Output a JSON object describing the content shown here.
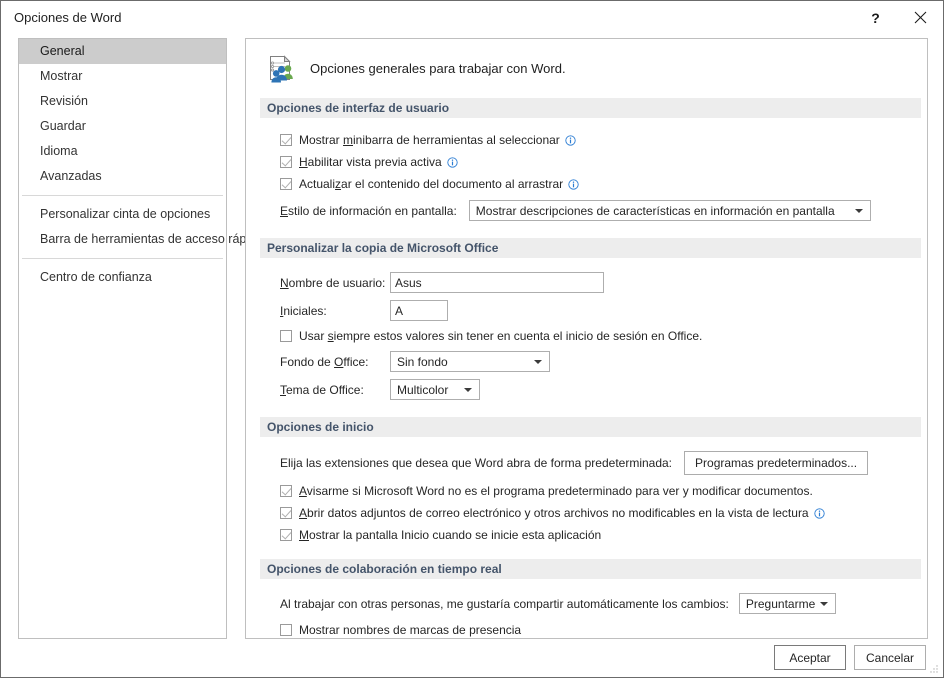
{
  "window": {
    "title": "Opciones de Word",
    "help_button": "?",
    "close_button": "✕"
  },
  "sidebar": {
    "items": [
      {
        "label": "General",
        "selected": true
      },
      {
        "label": "Mostrar",
        "selected": false
      },
      {
        "label": "Revisión",
        "selected": false
      },
      {
        "label": "Guardar",
        "selected": false
      },
      {
        "label": "Idioma",
        "selected": false
      },
      {
        "label": "Avanzadas",
        "selected": false
      },
      {
        "label": "Personalizar cinta de opciones",
        "selected": false
      },
      {
        "label": "Barra de herramientas de acceso rápido",
        "selected": false
      },
      {
        "label": "Centro de confianza",
        "selected": false
      }
    ]
  },
  "pane": {
    "header_text": "Opciones generales para trabajar con Word.",
    "header_icon": "general-options-icon"
  },
  "ui_section": {
    "title": "Opciones de interfaz de usuario",
    "cb_minibar": {
      "pre": "Mostrar ",
      "key": "m",
      "post": "inibarra de herramientas al seleccionar",
      "checked": true,
      "info": true
    },
    "cb_livepreview": {
      "pre": "",
      "key": "H",
      "post": "abilitar vista previa activa",
      "checked": true,
      "info": true
    },
    "cb_update_drag": {
      "pre": "Actuali",
      "key": "z",
      "post": "ar el contenido del documento al arrastrar",
      "checked": true,
      "info": true
    },
    "screentip_label": {
      "pre": "",
      "key": "E",
      "post": "stilo de información en pantalla:"
    },
    "screentip_value": "Mostrar descripciones de características en información en pantalla"
  },
  "personalize_section": {
    "title": "Personalizar la copia de Microsoft Office",
    "username_label": {
      "pre": "",
      "key": "N",
      "post": "ombre de usuario:"
    },
    "username_value": "Asus",
    "initials_label": {
      "pre": "",
      "key": "I",
      "post": "niciales:"
    },
    "initials_value": "A",
    "cb_always_use": {
      "pre": "Usar ",
      "key": "s",
      "post": "iempre estos valores sin tener en cuenta el inicio de sesión en Office.",
      "checked": false,
      "info": false
    },
    "background_label": {
      "pre": "Fondo de ",
      "key": "O",
      "post": "ffice:"
    },
    "background_value": "Sin fondo",
    "theme_label": {
      "pre": "",
      "key": "T",
      "post": "ema de Office:"
    },
    "theme_value": "Multicolor"
  },
  "startup_section": {
    "title": "Opciones de inicio",
    "extensions_label": "Elija las extensiones que desea que Word abra de forma predeterminada:",
    "default_programs_button": "Programas predeterminados...",
    "cb_warn_default": {
      "pre": "",
      "key": "A",
      "post": "visarme si Microsoft Word no es el programa predeterminado para ver y modificar documentos.",
      "checked": true,
      "info": false
    },
    "cb_open_attachments": {
      "pre": "",
      "key": "A",
      "post": "brir datos adjuntos de correo electrónico y otros archivos no modificables en la vista de lectura",
      "checked": true,
      "info": true
    },
    "cb_show_start": {
      "pre": "",
      "key": "M",
      "post": "ostrar la pantalla Inicio cuando se inicie esta aplicación",
      "checked": true,
      "info": false
    }
  },
  "collaboration_section": {
    "title": "Opciones de colaboración en tiempo real",
    "share_label": "Al trabajar con otras personas, me gustaría compartir automáticamente los cambios:",
    "share_value": "Preguntarme",
    "cb_presence_names": {
      "pre": "Mostrar nombres de marcas de presencia",
      "key": "",
      "post": "",
      "checked": false,
      "info": false
    }
  },
  "footer": {
    "ok_label": "Aceptar",
    "cancel_label": "Cancelar"
  },
  "colors": {
    "section_header_text": "#44546a",
    "section_header_bg": "#ededed",
    "selected_nav_bg": "#cccccc",
    "info_icon": "#2b7cd3"
  }
}
